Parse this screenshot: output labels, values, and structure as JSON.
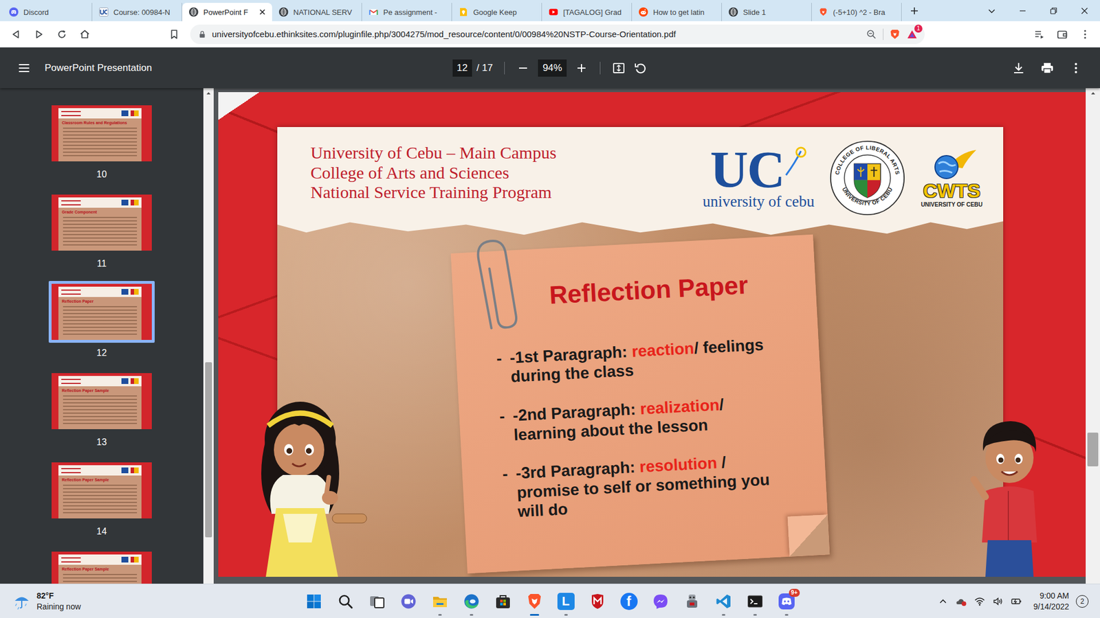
{
  "browser": {
    "tabs": [
      {
        "label": "Discord",
        "kind": "discord",
        "selected": false
      },
      {
        "label": "Course: 00984-N",
        "kind": "uc",
        "selected": false
      },
      {
        "label": "PowerPoint F",
        "kind": "web",
        "selected": true
      },
      {
        "label": "NATIONAL SERV",
        "kind": "web",
        "selected": false
      },
      {
        "label": "Pe assignment -",
        "kind": "gmail",
        "selected": false
      },
      {
        "label": "Google Keep",
        "kind": "keep",
        "selected": false
      },
      {
        "label": "[TAGALOG] Grad",
        "kind": "youtube",
        "selected": false
      },
      {
        "label": "How to get latin",
        "kind": "reddit",
        "selected": false
      },
      {
        "label": "Slide 1",
        "kind": "web",
        "selected": false
      },
      {
        "label": "(-5+10) ^2 - Bra",
        "kind": "brave",
        "selected": false
      }
    ],
    "url": "universityofcebu.ethinksites.com/pluginfile.php/3004275/mod_resource/content/0/00984%20NSTP-Course-Orientation.pdf",
    "rewards_badge": "1"
  },
  "pdf_viewer": {
    "title": "PowerPoint Presentation",
    "page": "12",
    "page_total": "/ 17",
    "zoom": "94%",
    "thumbnails": [
      {
        "page": "10",
        "title": "Classroom Rules and Regulations",
        "selected": false
      },
      {
        "page": "11",
        "title": "Grade Component",
        "selected": false
      },
      {
        "page": "12",
        "title": "Reflection Paper",
        "selected": true
      },
      {
        "page": "13",
        "title": "Reflection Paper Sample",
        "selected": false
      },
      {
        "page": "14",
        "title": "Reflection Paper Sample",
        "selected": false
      },
      {
        "title": "Reflection Paper Sample",
        "selected": false
      }
    ],
    "sidebar_scroll": {
      "position": 0.85,
      "size": 0.36
    },
    "page_scroll": {
      "position": 0.74,
      "size": 0.07
    }
  },
  "slide": {
    "header_lines": [
      "University of Cebu – Main Campus",
      "College of Arts and Sciences",
      "National Service Training Program"
    ],
    "uc_logo": {
      "mark": "UC",
      "caption": "university of cebu"
    },
    "seal": {
      "top": "COLLEGE OF LIBERAL ARTS",
      "bottom": "UNIVERSITY OF CEBU"
    },
    "cwts_logo": {
      "mark": "CWTS",
      "caption": "UNIVERSITY OF CEBU"
    },
    "note": {
      "title": "Reflection Paper",
      "items": [
        {
          "bullet": "-",
          "lead": "-1st Paragraph: ",
          "keyword": "reaction",
          "rest": "/ feelings during the class"
        },
        {
          "bullet": "-",
          "lead": "-2nd Paragraph: ",
          "keyword": "realization",
          "rest": "/ learning about the lesson"
        },
        {
          "bullet": "-",
          "lead": "-3rd Paragraph: ",
          "keyword": "resolution",
          "rest": " / promise to self or something you will do"
        }
      ]
    }
  },
  "taskbar": {
    "weather": {
      "temp": "82°F",
      "condition": "Raining now"
    },
    "apps": [
      {
        "kind": "start",
        "running": false,
        "focused": false
      },
      {
        "kind": "search",
        "running": false,
        "focused": false
      },
      {
        "kind": "task-view",
        "running": false,
        "focused": false
      },
      {
        "kind": "chat",
        "running": false,
        "focused": false
      },
      {
        "kind": "explorer",
        "running": true,
        "focused": false
      },
      {
        "kind": "edge",
        "running": true,
        "focused": false
      },
      {
        "kind": "store",
        "running": false,
        "focused": false
      },
      {
        "kind": "brave",
        "running": true,
        "focused": true
      },
      {
        "kind": "launcher",
        "glyph": "L",
        "running": true,
        "focused": false
      },
      {
        "kind": "mcafee",
        "running": false,
        "focused": false
      },
      {
        "kind": "facebook",
        "glyph": "f",
        "running": false,
        "focused": false
      },
      {
        "kind": "messenger",
        "running": false,
        "focused": false
      },
      {
        "kind": "game",
        "running": false,
        "focused": false
      },
      {
        "kind": "vscode",
        "running": true,
        "focused": false
      },
      {
        "kind": "terminal",
        "running": true,
        "focused": false
      },
      {
        "kind": "discord",
        "badge": "9+",
        "running": true,
        "focused": false
      }
    ],
    "time": "9:00 AM",
    "date": "9/14/2022",
    "notifications": "2"
  }
}
